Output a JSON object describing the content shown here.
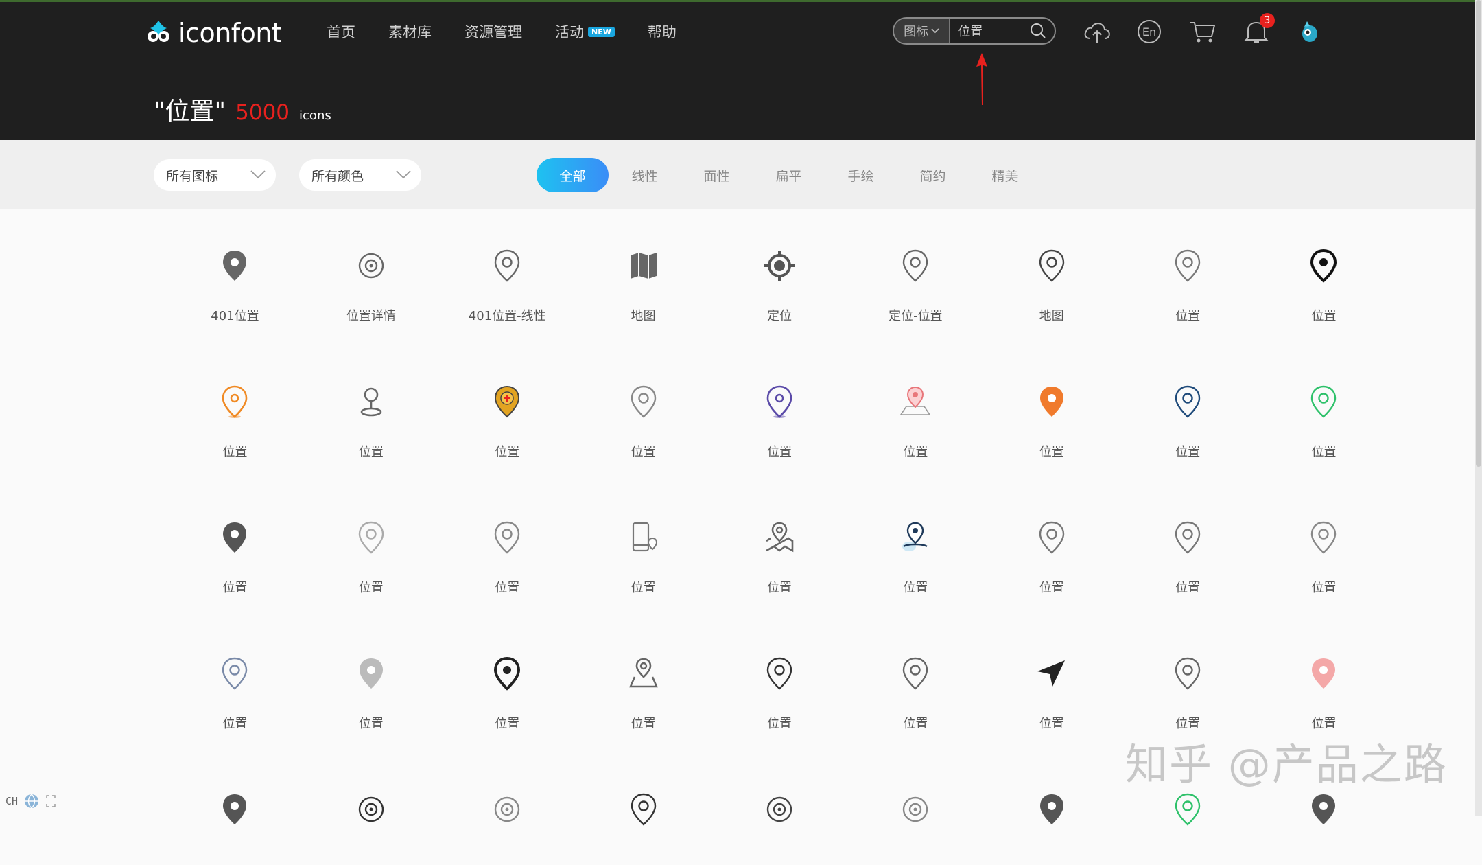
{
  "header": {
    "logo_text": "iconfont",
    "nav": [
      {
        "label": "首页"
      },
      {
        "label": "素材库"
      },
      {
        "label": "资源管理"
      },
      {
        "label": "活动",
        "badge": "NEW"
      },
      {
        "label": "帮助"
      }
    ],
    "search": {
      "type_label": "图标",
      "value": "位置"
    },
    "notifications_count": "3",
    "language_label": "En",
    "result": {
      "query": "\"位置\"",
      "count": "5000",
      "unit": "icons"
    }
  },
  "filters": {
    "type_dropdown": "所有图标",
    "color_dropdown": "所有颜色",
    "tabs": [
      "全部",
      "线性",
      "面性",
      "扁平",
      "手绘",
      "简约",
      "精美"
    ],
    "active_tab": "全部"
  },
  "icons": [
    [
      {
        "label": "401位置",
        "icon": "map-pin-solid-icon",
        "color": "#666666"
      },
      {
        "label": "位置详情",
        "icon": "target-pin-icon",
        "color": "#666666"
      },
      {
        "label": "401位置-线性",
        "icon": "map-pin-outline-icon",
        "color": "#666666"
      },
      {
        "label": "地图",
        "icon": "folded-map-icon",
        "color": "#666666"
      },
      {
        "label": "定位",
        "icon": "gps-locate-icon",
        "color": "#555555"
      },
      {
        "label": "定位-位置",
        "icon": "map-pin-outline-icon",
        "color": "#666666"
      },
      {
        "label": "地图",
        "icon": "map-pin-outline-icon",
        "color": "#444444"
      },
      {
        "label": "位置",
        "icon": "map-pin-outline-icon",
        "color": "#777777"
      },
      {
        "label": "位置",
        "icon": "map-pin-bold-icon",
        "color": "#111111"
      }
    ],
    [
      {
        "label": "位置",
        "icon": "map-pin-icon",
        "color": "#f08a24"
      },
      {
        "label": "位置",
        "icon": "person-pin-icon",
        "color": "#666666"
      },
      {
        "label": "位置",
        "icon": "map-pin-plus-icon",
        "color": "#e2a321"
      },
      {
        "label": "位置",
        "icon": "map-pin-outline-icon",
        "color": "#888888"
      },
      {
        "label": "位置",
        "icon": "map-pin-icon",
        "color": "#5a4aa8"
      },
      {
        "label": "位置",
        "icon": "map-area-pin-icon",
        "color": "#e8767a"
      },
      {
        "label": "位置",
        "icon": "map-pin-solid-icon",
        "color": "#f07a2c"
      },
      {
        "label": "位置",
        "icon": "map-pin-outline-icon",
        "color": "#1e4a7a"
      },
      {
        "label": "位置",
        "icon": "map-pin-outline-icon",
        "color": "#2ec16a"
      }
    ],
    [
      {
        "label": "位置",
        "icon": "map-pin-solid-icon",
        "color": "#555555"
      },
      {
        "label": "位置",
        "icon": "map-pin-outline-icon",
        "color": "#aaaaaa"
      },
      {
        "label": "位置",
        "icon": "map-pin-outline-icon",
        "color": "#888888"
      },
      {
        "label": "位置",
        "icon": "phone-location-icon",
        "color": "#777777"
      },
      {
        "label": "位置",
        "icon": "map-route-pin-icon",
        "color": "#666666"
      },
      {
        "label": "位置",
        "icon": "person-location-icon",
        "color": "#1f3a5a"
      },
      {
        "label": "位置",
        "icon": "map-pin-outline-icon",
        "color": "#777777"
      },
      {
        "label": "位置",
        "icon": "map-pin-outline-icon",
        "color": "#777777"
      },
      {
        "label": "位置",
        "icon": "map-pin-outline-icon",
        "color": "#888888"
      }
    ],
    [
      {
        "label": "位置",
        "icon": "map-pin-outline-icon",
        "color": "#7a8aa8"
      },
      {
        "label": "位置",
        "icon": "map-pin-solid-icon",
        "color": "#bbbbbb"
      },
      {
        "label": "位置",
        "icon": "map-pin-bold-icon",
        "color": "#222222"
      },
      {
        "label": "位置",
        "icon": "map-pin-area-icon",
        "color": "#666666"
      },
      {
        "label": "位置",
        "icon": "map-pin-outline-icon",
        "color": "#333333"
      },
      {
        "label": "位置",
        "icon": "map-pin-outline-icon",
        "color": "#666666"
      },
      {
        "label": "位置",
        "icon": "navigation-arrow-icon",
        "color": "#222222"
      },
      {
        "label": "位置",
        "icon": "map-pin-outline-icon",
        "color": "#666666"
      },
      {
        "label": "位置",
        "icon": "map-pin-solid-icon",
        "color": "#f4a8a8"
      }
    ],
    [
      {
        "label": "",
        "icon": "map-pin-solid-icon",
        "color": "#555555"
      },
      {
        "label": "",
        "icon": "target-pin-icon",
        "color": "#333333"
      },
      {
        "label": "",
        "icon": "target-pin-icon",
        "color": "#888888"
      },
      {
        "label": "",
        "icon": "map-pin-outline-icon",
        "color": "#333333"
      },
      {
        "label": "",
        "icon": "target-pin-icon",
        "color": "#444444"
      },
      {
        "label": "",
        "icon": "target-pin-icon",
        "color": "#888888"
      },
      {
        "label": "",
        "icon": "map-pin-solid-icon",
        "color": "#555555"
      },
      {
        "label": "",
        "icon": "map-pin-outline-icon",
        "color": "#2ec16a"
      },
      {
        "label": "",
        "icon": "map-pin-solid-icon",
        "color": "#555555"
      }
    ]
  ],
  "watermark": "知乎 @产品之路",
  "ime_label": "CH"
}
